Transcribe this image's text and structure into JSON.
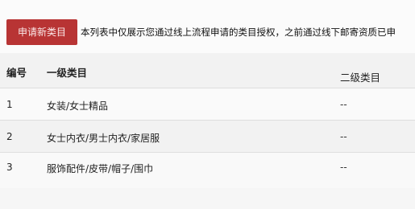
{
  "toolbar": {
    "apply_button_label": "申请新类目",
    "notice_text": "本列表中仅展示您通过线上流程申请的类目授权，之前通过线下邮寄资质已申"
  },
  "table": {
    "headers": {
      "no": "编号",
      "level1": "一级类目",
      "level2": "二级类目"
    },
    "rows": [
      {
        "no": "1",
        "level1": "女装/女士精品",
        "level2": "--"
      },
      {
        "no": "2",
        "level1": "女士内衣/男士内衣/家居服",
        "level2": "--"
      },
      {
        "no": "3",
        "level1": "服饰配件/皮带/帽子/围巾",
        "level2": "--"
      }
    ]
  },
  "colors": {
    "accent_button": "#b83434"
  }
}
